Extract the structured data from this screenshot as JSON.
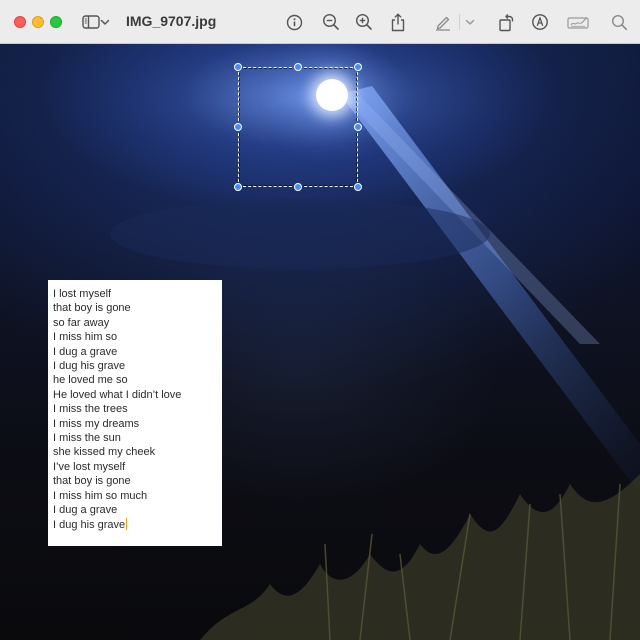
{
  "window": {
    "title": "IMG_9707.jpg"
  },
  "toolbar": {
    "icons": [
      "sidebar-icon",
      "chevron-down-icon",
      "info-icon",
      "zoom-out-icon",
      "zoom-in-icon",
      "share-icon",
      "highlight-pen-icon",
      "chevron-down-icon",
      "rotate-icon",
      "markup-icon",
      "signature-icon",
      "search-icon"
    ]
  },
  "textbox": {
    "lines": [
      "I lost myself",
      "that boy is gone",
      "so far away",
      "I miss him so",
      "I dug a grave",
      "I dug his grave",
      "he loved me so",
      "He loved what I didn’t love",
      "I miss the trees",
      "I miss my dreams",
      "I miss the sun",
      "she kissed my cheek",
      "I’ve lost myself",
      "that boy is gone",
      "I miss him so much",
      "I dug a grave",
      "I dug his grave"
    ]
  },
  "colors": {
    "selection_handle": "#4a8df7",
    "caret": "#e8a020",
    "close": "#fe5f57",
    "minimize": "#febc2e",
    "maximize": "#28c840"
  }
}
